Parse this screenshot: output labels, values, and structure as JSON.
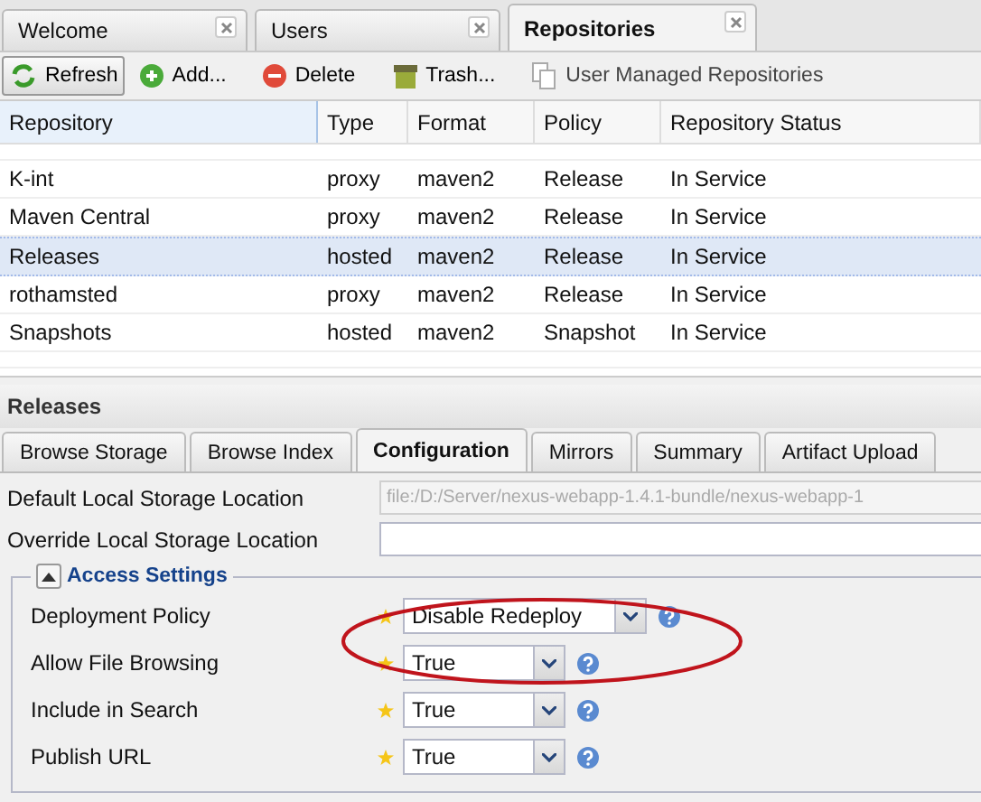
{
  "tabs": [
    {
      "label": "Welcome",
      "selected": false
    },
    {
      "label": "Users",
      "selected": false
    },
    {
      "label": "Repositories",
      "selected": true
    }
  ],
  "toolbar": [
    {
      "label": "Refresh",
      "kind": "refresh",
      "framed": true
    },
    {
      "label": "Add...",
      "kind": "add",
      "framed": false
    },
    {
      "label": "Delete",
      "kind": "delete",
      "framed": false
    },
    {
      "label": "Trash...",
      "kind": "trash",
      "framed": false
    },
    {
      "label": "User Managed Repositories",
      "kind": "copy",
      "framed": false
    }
  ],
  "table": {
    "columns": [
      "Repository",
      "Type",
      "Format",
      "Policy",
      "Repository Status"
    ],
    "rows": [
      {
        "cells": [
          "K-int",
          "proxy",
          "maven2",
          "Release",
          "In Service"
        ],
        "selected": false
      },
      {
        "cells": [
          "Maven Central",
          "proxy",
          "maven2",
          "Release",
          "In Service"
        ],
        "selected": false
      },
      {
        "cells": [
          "Releases",
          "hosted",
          "maven2",
          "Release",
          "In Service"
        ],
        "selected": true
      },
      {
        "cells": [
          "rothamsted",
          "proxy",
          "maven2",
          "Release",
          "In Service"
        ],
        "selected": false
      },
      {
        "cells": [
          "Snapshots",
          "hosted",
          "maven2",
          "Snapshot",
          "In Service"
        ],
        "selected": false
      }
    ]
  },
  "panel": {
    "title": "Releases",
    "tabs": [
      {
        "label": "Browse Storage",
        "selected": false
      },
      {
        "label": "Browse Index",
        "selected": false
      },
      {
        "label": "Configuration",
        "selected": true
      },
      {
        "label": "Mirrors",
        "selected": false
      },
      {
        "label": "Summary",
        "selected": false
      },
      {
        "label": "Artifact Upload",
        "selected": false
      }
    ],
    "locations": [
      {
        "label": "Default Local Storage Location",
        "value": "file:/D:/Server/nexus-webapp-1.4.1-bundle/nexus-webapp-1",
        "disabled": true
      },
      {
        "label": "Override Local Storage Location",
        "disabled": false
      }
    ],
    "section": {
      "title": "Access Settings",
      "expanded": true
    },
    "settings": [
      {
        "label": "Deployment Policy",
        "value": "Disable Redeploy",
        "required": true,
        "wide": true
      },
      {
        "label": "Allow File Browsing",
        "value": "True",
        "required": true,
        "wide": false
      },
      {
        "label": "Include in Search",
        "value": "True",
        "required": true,
        "wide": false
      },
      {
        "label": "Publish URL",
        "value": "True",
        "required": true,
        "wide": false
      }
    ]
  }
}
